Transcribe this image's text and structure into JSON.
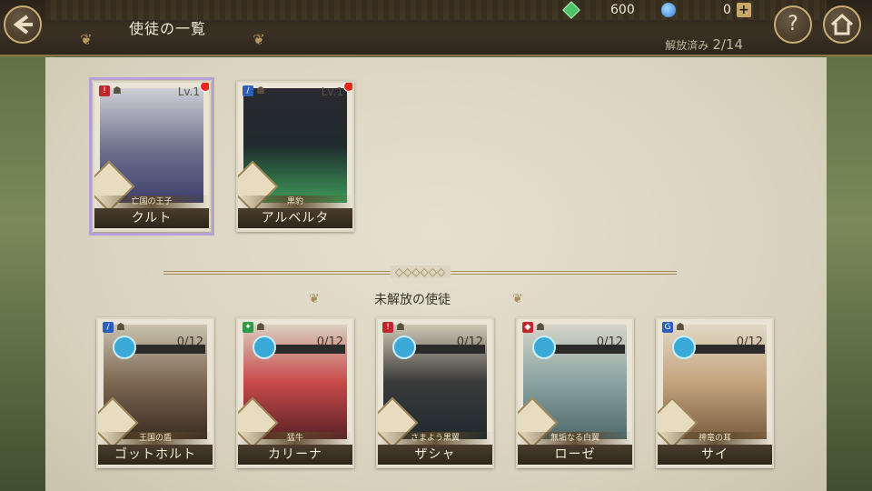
{
  "header": {
    "title": "使徒の一覧",
    "released_label": "解放済み",
    "released_count": "2/14",
    "gems": "600",
    "orbs": "0"
  },
  "unlocked": [
    {
      "name": "クルト",
      "subtitle": "亡国の王子",
      "level": "Lv.1",
      "selected": true,
      "tag_color": "#c0272d",
      "tag": "!"
    },
    {
      "name": "アルベルタ",
      "subtitle": "黒豹",
      "level": "Lv.1",
      "selected": false,
      "tag_color": "#2b5fb8",
      "tag": "/"
    }
  ],
  "section_title": "未解放の使徒",
  "locked": [
    {
      "name": "ゴットホルト",
      "subtitle": "王国の盾",
      "count": "0/12",
      "progress": 0,
      "tag_color": "#2b5fb8",
      "tag": "/"
    },
    {
      "name": "カリーナ",
      "subtitle": "猛牛",
      "count": "0/12",
      "progress": 0,
      "tag_color": "#2f9a4a",
      "tag": "✦"
    },
    {
      "name": "ザシャ",
      "subtitle": "さまよう黒翼",
      "count": "0/12",
      "progress": 0,
      "tag_color": "#c0272d",
      "tag": "!"
    },
    {
      "name": "ローゼ",
      "subtitle": "無垢なる白翼",
      "count": "0/12",
      "progress": 0,
      "tag_color": "#c0272d",
      "tag": "◆"
    },
    {
      "name": "サイ",
      "subtitle": "神竜の耳",
      "count": "0/12",
      "progress": 0,
      "tag_color": "#2b5fb8",
      "tag": "G"
    }
  ],
  "colors": {
    "accent_gold": "#c9ad72",
    "notify_red": "#e6251d",
    "fragment_blue": "#3ba9d8"
  },
  "icons": {
    "back": "back-arrow-icon",
    "help": "help-icon",
    "home": "home-icon"
  }
}
